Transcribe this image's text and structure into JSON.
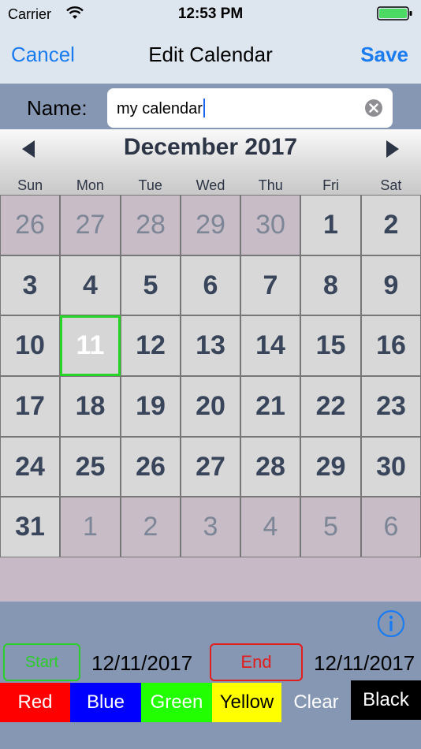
{
  "status_bar": {
    "carrier": "Carrier",
    "time": "12:53 PM"
  },
  "nav": {
    "cancel_label": "Cancel",
    "title": "Edit Calendar",
    "save_label": "Save"
  },
  "name_field": {
    "label": "Name:",
    "value": "my calendar"
  },
  "calendar": {
    "month_title": "December 2017",
    "weekdays": [
      "Sun",
      "Mon",
      "Tue",
      "Wed",
      "Thu",
      "Fri",
      "Sat"
    ],
    "weeks": [
      [
        "26",
        "27",
        "28",
        "29",
        "30",
        "1",
        "2"
      ],
      [
        "3",
        "4",
        "5",
        "6",
        "7",
        "8",
        "9"
      ],
      [
        "10",
        "11",
        "12",
        "13",
        "14",
        "15",
        "16"
      ],
      [
        "17",
        "18",
        "19",
        "20",
        "21",
        "22",
        "23"
      ],
      [
        "24",
        "25",
        "26",
        "27",
        "28",
        "29",
        "30"
      ],
      [
        "31",
        "1",
        "2",
        "3",
        "4",
        "5",
        "6"
      ]
    ],
    "selected_day": "11"
  },
  "range": {
    "start_label": "Start",
    "start_date": "12/11/2017",
    "end_label": "End",
    "end_date": "12/11/2017"
  },
  "colors": {
    "red": "Red",
    "blue": "Blue",
    "green": "Green",
    "yellow": "Yellow",
    "clear": "Clear",
    "black": "Black"
  },
  "theme": {
    "accent": "#1a7cf0",
    "selected_border": "#27d327",
    "start_color": "#2bcd2b",
    "end_color": "#e21d1d"
  }
}
